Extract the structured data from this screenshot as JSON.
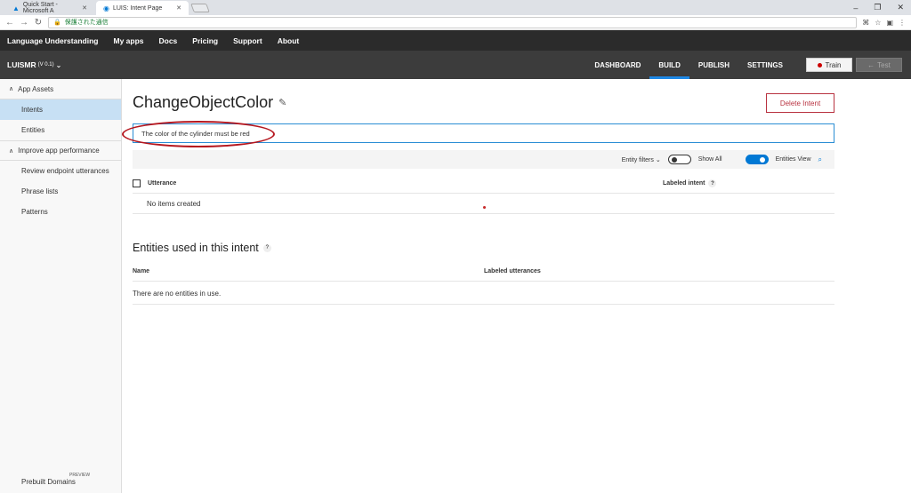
{
  "browser": {
    "tabs": [
      {
        "title": "Quick Start - Microsoft A"
      },
      {
        "title": "LUIS: Intent Page"
      }
    ],
    "address_text": "保護された通信"
  },
  "topnav": [
    "Language Understanding",
    "My apps",
    "Docs",
    "Pricing",
    "Support",
    "About"
  ],
  "appbar": {
    "app_name": "LUISMR",
    "version": "(V 0.1)",
    "tabs": [
      "DASHBOARD",
      "BUILD",
      "PUBLISH",
      "SETTINGS"
    ],
    "active_tab": "BUILD",
    "train_label": "Train",
    "test_label": "Test"
  },
  "sidebar": {
    "group1": "App Assets",
    "items1": [
      "Intents",
      "Entities"
    ],
    "group2": "Improve app performance",
    "items2": [
      "Review endpoint utterances",
      "Phrase lists",
      "Patterns"
    ],
    "bottom_label": "Prebuilt Domains",
    "bottom_badge": "PREVIEW"
  },
  "main": {
    "title": "ChangeObjectColor",
    "delete_label": "Delete Intent",
    "utterance_value": "The color of the cylinder must be red",
    "filters": {
      "entity_filters": "Entity filters",
      "show_all": "Show All",
      "entities_view": "Entities View"
    },
    "utterances_table": {
      "col_utterance": "Utterance",
      "col_labeled_intent": "Labeled intent",
      "empty": "No items created"
    },
    "entities_section": {
      "title": "Entities used in this intent",
      "col_name": "Name",
      "col_labeled_utterances": "Labeled utterances",
      "empty": "There are no entities in use."
    }
  },
  "colors": {
    "accent": "#0078d4",
    "delete": "#b83240",
    "annotation": "#b5161e"
  }
}
